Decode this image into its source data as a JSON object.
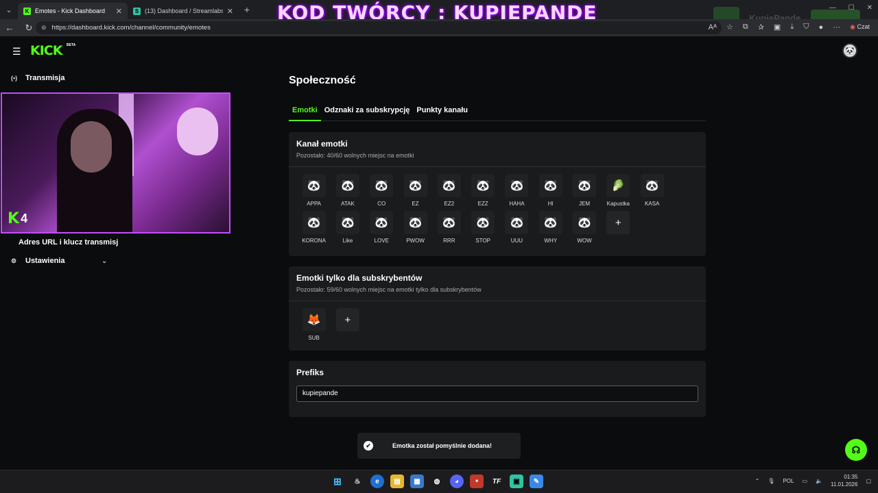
{
  "browser": {
    "tabs": [
      {
        "title": "Emotes - Kick Dashboard",
        "favicon": "K",
        "active": true
      },
      {
        "title": "(13) Dashboard / Streamlabs",
        "favicon": "S",
        "active": false
      }
    ],
    "url": "https://dashboard.kick.com/channel/community/emotes",
    "chat_label": "Czat"
  },
  "overlay": {
    "banner": "KOD TWÓRCY : KUPIEPANDE",
    "ghost_name": "KupiePande"
  },
  "header": {
    "logo": "KICK",
    "logo_badge": "BETA"
  },
  "sidebar": {
    "items": [
      {
        "label": "Transmisja",
        "icon": "broadcast-icon"
      },
      {
        "label": "Adres URL i klucz transmisj",
        "icon": "key-icon"
      },
      {
        "label": "Ustawienia",
        "icon": "gear-icon"
      }
    ]
  },
  "webcam": {
    "badge": "4"
  },
  "main": {
    "title": "Społeczność",
    "tabs": [
      {
        "label": "Emotki",
        "active": true
      },
      {
        "label": "Odznaki za subskrypcję",
        "active": false
      },
      {
        "label": "Punkty kanału",
        "active": false
      }
    ]
  },
  "channel_emotes": {
    "title": "Kanał emotki",
    "subtitle": "Pozostało: 40/60 wolnych miejsc na emotki",
    "emotes": [
      {
        "name": "APPA",
        "glyph": "🐼"
      },
      {
        "name": "ATAK",
        "glyph": "🐼"
      },
      {
        "name": "CO",
        "glyph": "🐼"
      },
      {
        "name": "EZ",
        "glyph": "🐼"
      },
      {
        "name": "EZ2",
        "glyph": "🐼"
      },
      {
        "name": "EZZ",
        "glyph": "🐼"
      },
      {
        "name": "HAHA",
        "glyph": "🐼"
      },
      {
        "name": "HI",
        "glyph": "🐼"
      },
      {
        "name": "JEM",
        "glyph": "🐼"
      },
      {
        "name": "Kapustka",
        "glyph": "🥬"
      },
      {
        "name": "KASA",
        "glyph": "🐼"
      },
      {
        "name": "KORONA",
        "glyph": "🐼"
      },
      {
        "name": "Like",
        "glyph": "🐼"
      },
      {
        "name": "LOVE",
        "glyph": "🐼"
      },
      {
        "name": "PWOW",
        "glyph": "🐼"
      },
      {
        "name": "RRR",
        "glyph": "🐼"
      },
      {
        "name": "STOP",
        "glyph": "🐼"
      },
      {
        "name": "UUU",
        "glyph": "🐼"
      },
      {
        "name": "WHY",
        "glyph": "🐼"
      },
      {
        "name": "WOW",
        "glyph": "🐼"
      }
    ]
  },
  "sub_emotes": {
    "title": "Emotki tylko dla subskrybentów",
    "subtitle": "Pozostało: 59/60 wolnych miejsc na emotki tylko dla subskrybentów",
    "emotes": [
      {
        "name": "SUB",
        "glyph": "🦊"
      }
    ]
  },
  "prefix": {
    "title": "Prefiks",
    "value": "kupiepande"
  },
  "toast": {
    "message": "Emotka został pomyślnie dodana!"
  },
  "taskbar": {
    "language": "POL",
    "time": "01:35",
    "date": "11.01.2026"
  },
  "colors": {
    "accent": "#53fc18",
    "background": "#0b0c0d",
    "card": "#191b1c",
    "webcam_border": "#c44dff"
  }
}
